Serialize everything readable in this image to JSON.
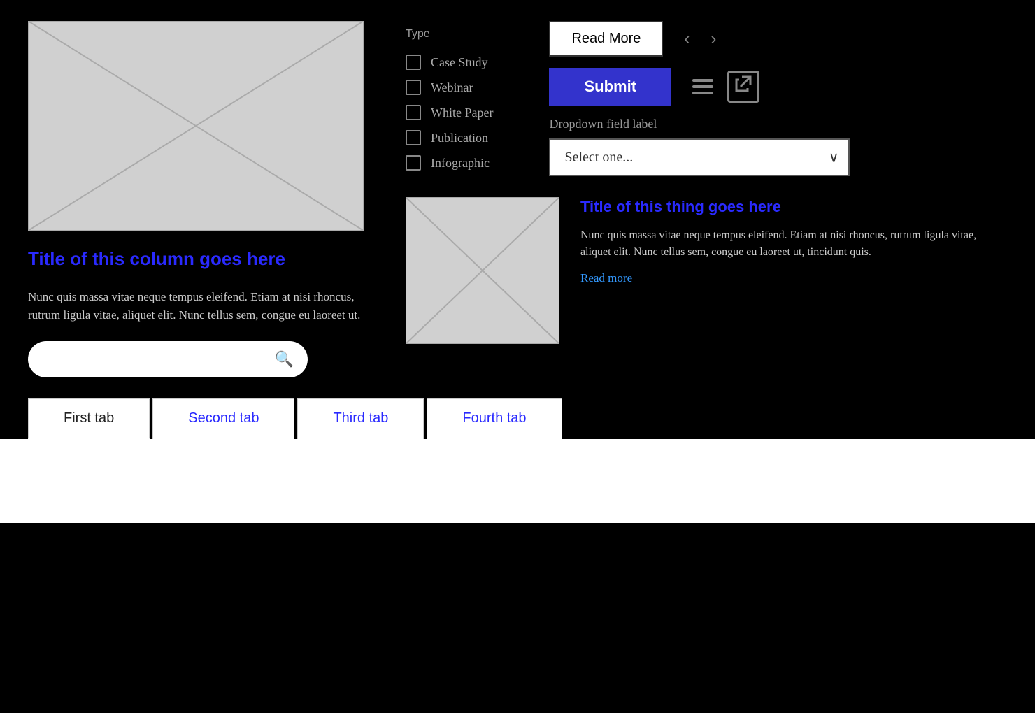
{
  "left": {
    "column_title": "Title of this column goes here",
    "column_body": "Nunc quis massa vitae neque tempus eleifend. Etiam at nisi rhoncus, rutrum ligula vitae, aliquet elit. Nunc tellus sem, congue eu laoreet ut.",
    "search_placeholder": ""
  },
  "right": {
    "type_label": "Type",
    "checkboxes": [
      {
        "label": "Case Study"
      },
      {
        "label": "Webinar"
      },
      {
        "label": "White Paper"
      },
      {
        "label": "Publication"
      },
      {
        "label": "Infographic"
      }
    ],
    "read_more_label": "Read More",
    "submit_label": "Submit",
    "dropdown_label": "Dropdown field label",
    "dropdown_placeholder": "Select one...",
    "card": {
      "title": "Title of this thing goes here",
      "body": "Nunc quis massa vitae neque tempus eleifend. Etiam at nisi rhoncus, rutrum ligula vitae, aliquet elit. Nunc tellus sem, congue eu laoreet ut, tincidunt quis.",
      "read_more": "Read more"
    }
  },
  "tabs": {
    "items": [
      {
        "label": "First tab",
        "active": true
      },
      {
        "label": "Second tab",
        "active": false
      },
      {
        "label": "Third tab",
        "active": false
      },
      {
        "label": "Fourth tab",
        "active": false
      }
    ]
  }
}
